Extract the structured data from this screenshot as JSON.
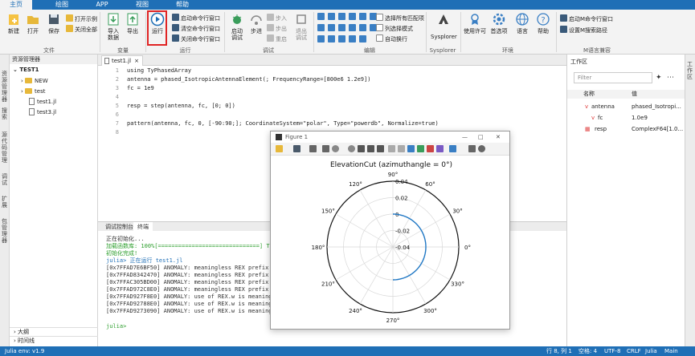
{
  "menu": {
    "tabs": [
      "主页",
      "绘图",
      "APP",
      "视图",
      "帮助"
    ],
    "active_index": 0
  },
  "ribbon": {
    "file": {
      "new": "新建",
      "open": "打开",
      "save": "保存",
      "open_example": "打开示例",
      "close_all": "关闭全部",
      "group": "文件"
    },
    "variables": {
      "import": "导入\n数据",
      "export": "导出",
      "group": "变量"
    },
    "run": {
      "run": "运行",
      "start_cmd": "启动命令行窗口",
      "clear_cmd": "清空命令行窗口",
      "close_cmd": "关闭命令行窗口",
      "group": "运行"
    },
    "debug": {
      "start": "启动\n调试",
      "step": "步进",
      "step_in": "步入",
      "step_out": "步出",
      "restart": "重启",
      "exit": "退出\n调试",
      "group": "调试"
    },
    "edit": {
      "select_all_match": "选择所有匹配项",
      "column_select": "列选择模式",
      "auto_wrap": "自动换行",
      "group": "编辑"
    },
    "sysplorer": {
      "label": "Sysplorer",
      "group": "Sysplorer"
    },
    "env": {
      "license": "使用许可",
      "preferences": "首选项",
      "language": "语言",
      "help": "帮助",
      "group": "环境"
    },
    "mworks": {
      "start_m_cmd": "启动M命令行窗口",
      "set_m_path": "设置M搜索路径",
      "group": "M语言兼容"
    }
  },
  "left_strip": [
    "资源管理器",
    "搜索",
    "源代码管理",
    "调试",
    "扩展",
    "包管理器"
  ],
  "explorer": {
    "title": "资源管理器",
    "root": "TEST1",
    "items": [
      {
        "type": "folder",
        "name": "NEW"
      },
      {
        "type": "folder",
        "name": "test"
      },
      {
        "type": "file",
        "name": "test1.jl"
      },
      {
        "type": "file",
        "name": "test3.jl"
      }
    ],
    "outline": "大纲",
    "timeline": "时间线"
  },
  "editor": {
    "tab": "test1.jl",
    "line_numbers": [
      "1",
      "2",
      "3",
      "4",
      "5",
      "6",
      "7",
      "8"
    ],
    "lines": [
      "using TyPhasedArray",
      "antenna = phased_IsotropicAntennaElement(; FrequencyRange=[800e6 1.2e9])",
      "fc = 1e9",
      "",
      "resp = step(antenna, fc, [0; 0])",
      "",
      "pattern(antenna, fc, 0, [-90:90;]; CoordinateSystem=\"polar\", Type=\"powerdb\", Normalize=true)",
      ""
    ]
  },
  "console": {
    "tabs": [
      "调试控制台",
      "终端"
    ],
    "active_index": 1,
    "lines": [
      "正在初始化...",
      "加载函数库: 100%[==============================] Ti",
      "初始化完成!",
      "julia> 正在运行 test1.jl",
      "[0x7FFAD7E6BF50] ANOMALY: meaningless REX prefix us",
      "[0x7FFAD8342470] ANOMALY: meaningless REX prefix us",
      "[0x7FFAC305BD00] ANOMALY: meaningless REX prefix us",
      "[0x7FFAD972C8E0] ANOMALY: meaningless REX prefix us",
      "[0x7FFAD927F8E0] ANOMALY: use of REX.w is meaningle",
      "[0x7FFAD92788E0] ANOMALY: use of REX.w is meaningle",
      "[0x7FFAD9273090] ANOMALY: use of REX.w is meaningle",
      "",
      "julia> "
    ]
  },
  "workspace": {
    "title": "工作区",
    "filter_placeholder": "Filter",
    "col_name": "名称",
    "col_value": "值",
    "rows": [
      {
        "name": "antenna",
        "value": "phased_Isotropi..."
      },
      {
        "name": "fc",
        "value": "1.0e9"
      },
      {
        "name": "resp",
        "value": "ComplexF64[1.0..."
      }
    ]
  },
  "right_strip": "工作区",
  "figure": {
    "window_title": "Figure 1",
    "plot_title": "ElevationCut (azimuthangle = 0°)",
    "angle_labels": [
      "90°",
      "60°",
      "30°",
      "0°",
      "330°",
      "300°",
      "270°",
      "240°",
      "210°",
      "180°",
      "150°",
      "120°"
    ],
    "radial_labels": [
      "0.04",
      "0.02",
      "0",
      "-0.02",
      "-0.04"
    ],
    "colors": {
      "curve": "#1f77c4"
    }
  },
  "chart_data": {
    "type": "polar-line",
    "title": "ElevationCut (azimuthangle = 0°)",
    "theta_deg": [
      -90,
      -60,
      -30,
      0,
      30,
      60,
      90
    ],
    "r_powerdb": [
      0,
      0,
      0,
      0,
      0,
      0,
      0
    ],
    "radial_ticks": [
      0.04,
      0.02,
      0,
      -0.02,
      -0.04
    ],
    "angular_ticks_deg": [
      0,
      30,
      60,
      90,
      120,
      150,
      180,
      210,
      240,
      270,
      300,
      330
    ]
  },
  "statusbar": {
    "env": "Julia env: v1.9",
    "position": "行 8, 列 1",
    "spaces": "空格: 4",
    "encoding": "UTF-8",
    "eol": "CRLF",
    "language": "Julia",
    "branch": "Main"
  },
  "colors": {
    "accent": "#1f6fb6",
    "run_highlight": "#e02424"
  }
}
